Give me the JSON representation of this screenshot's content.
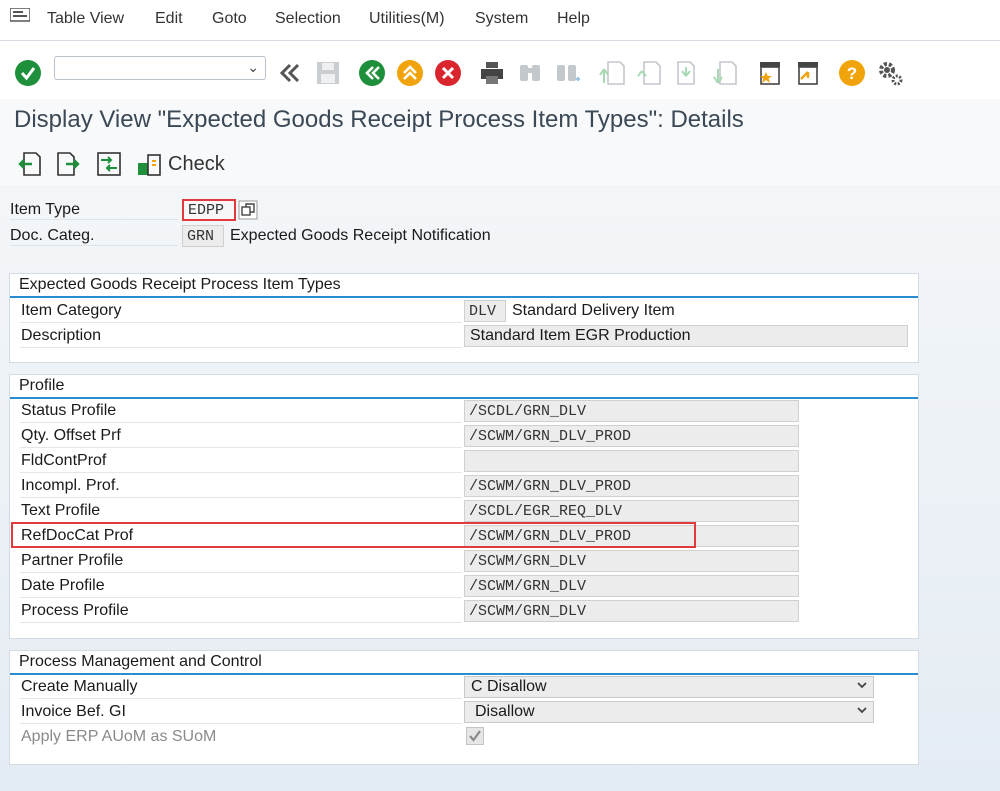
{
  "menu": {
    "items": [
      "Table View",
      "Edit",
      "Goto",
      "Selection",
      "Utilities(M)",
      "System",
      "Help"
    ]
  },
  "toolbar": {
    "command_value": "",
    "icons": [
      "enter-icon",
      "back-arrows-icon",
      "save-icon",
      "back-icon",
      "exit-icon",
      "cancel-icon",
      "print-icon",
      "find-icon",
      "find-next-icon",
      "first-page-icon",
      "previous-page-icon",
      "next-page-icon",
      "last-page-icon",
      "create-shortcut-icon",
      "customize-icon",
      "help-icon",
      "settings-icon"
    ]
  },
  "title": "Display View \"Expected Goods Receipt Process Item Types\": Details",
  "app_toolbar": {
    "check_label": "Check"
  },
  "header": {
    "item_type_label": "Item Type",
    "item_type_value": "EDPP",
    "doc_categ_label": "Doc. Categ.",
    "doc_categ_value": "GRN",
    "doc_categ_text": "Expected Goods Receipt Notification"
  },
  "section1": {
    "title": "Expected Goods Receipt Process Item Types",
    "item_category_label": "Item Category",
    "item_category_value": "DLV",
    "item_category_text": "Standard Delivery Item",
    "description_label": "Description",
    "description_value": "Standard Item EGR Production"
  },
  "profile": {
    "title": "Profile",
    "rows": [
      {
        "label": "Status Profile",
        "value": "/SCDL/GRN_DLV"
      },
      {
        "label": "Qty. Offset Prf",
        "value": "/SCWM/GRN_DLV_PROD"
      },
      {
        "label": "FldContProf",
        "value": ""
      },
      {
        "label": "Incompl. Prof.",
        "value": "/SCWM/GRN_DLV_PROD"
      },
      {
        "label": "Text Profile",
        "value": "/SCDL/EGR_REQ_DLV"
      },
      {
        "label": "RefDocCat Prof",
        "value": "/SCWM/GRN_DLV_PROD"
      },
      {
        "label": "Partner Profile",
        "value": "/SCWM/GRN_DLV"
      },
      {
        "label": "Date Profile",
        "value": "/SCWM/GRN_DLV"
      },
      {
        "label": "Process Profile",
        "value": "/SCWM/GRN_DLV"
      }
    ]
  },
  "process": {
    "title": "Process Management and Control",
    "create_manually_label": "Create Manually",
    "create_manually_value": "C Disallow",
    "invoice_label": "Invoice Bef. GI",
    "invoice_value": "Disallow",
    "apply_erp_label": "Apply ERP AUoM as SUoM",
    "apply_erp_checked": true
  },
  "colors": {
    "accent_blue": "#2b8ccf",
    "highlight_red": "#e0393e",
    "green": "#1e8f3b"
  }
}
